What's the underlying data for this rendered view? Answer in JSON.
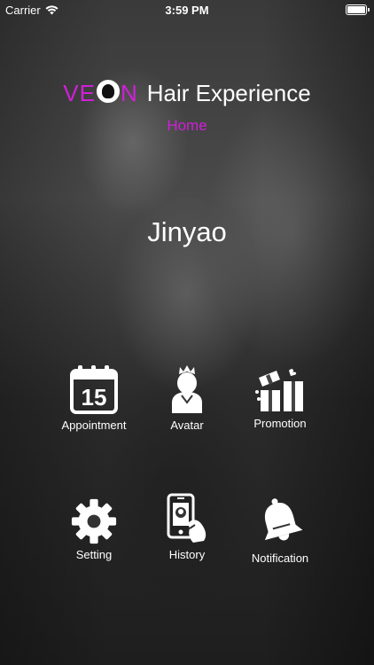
{
  "status_bar": {
    "carrier": "Carrier",
    "time": "3:59 PM"
  },
  "header": {
    "brand_logo_left": "VE",
    "brand_logo_right": "N",
    "brand_title": "Hair Experience",
    "nav_label": "Home"
  },
  "user": {
    "name": "Jinyao"
  },
  "menu": {
    "appointment": {
      "label": "Appointment",
      "icon": "calendar-icon",
      "day": "15"
    },
    "avatar": {
      "label": "Avatar",
      "icon": "avatar-icon"
    },
    "promotion": {
      "label": "Promotion",
      "icon": "gift-icon"
    },
    "setting": {
      "label": "Setting",
      "icon": "gear-icon"
    },
    "history": {
      "label": "History",
      "icon": "phone-history-icon"
    },
    "notification": {
      "label": "Notification",
      "icon": "bell-icon"
    }
  },
  "colors": {
    "accent": "#d11fd9",
    "text": "#ffffff"
  }
}
